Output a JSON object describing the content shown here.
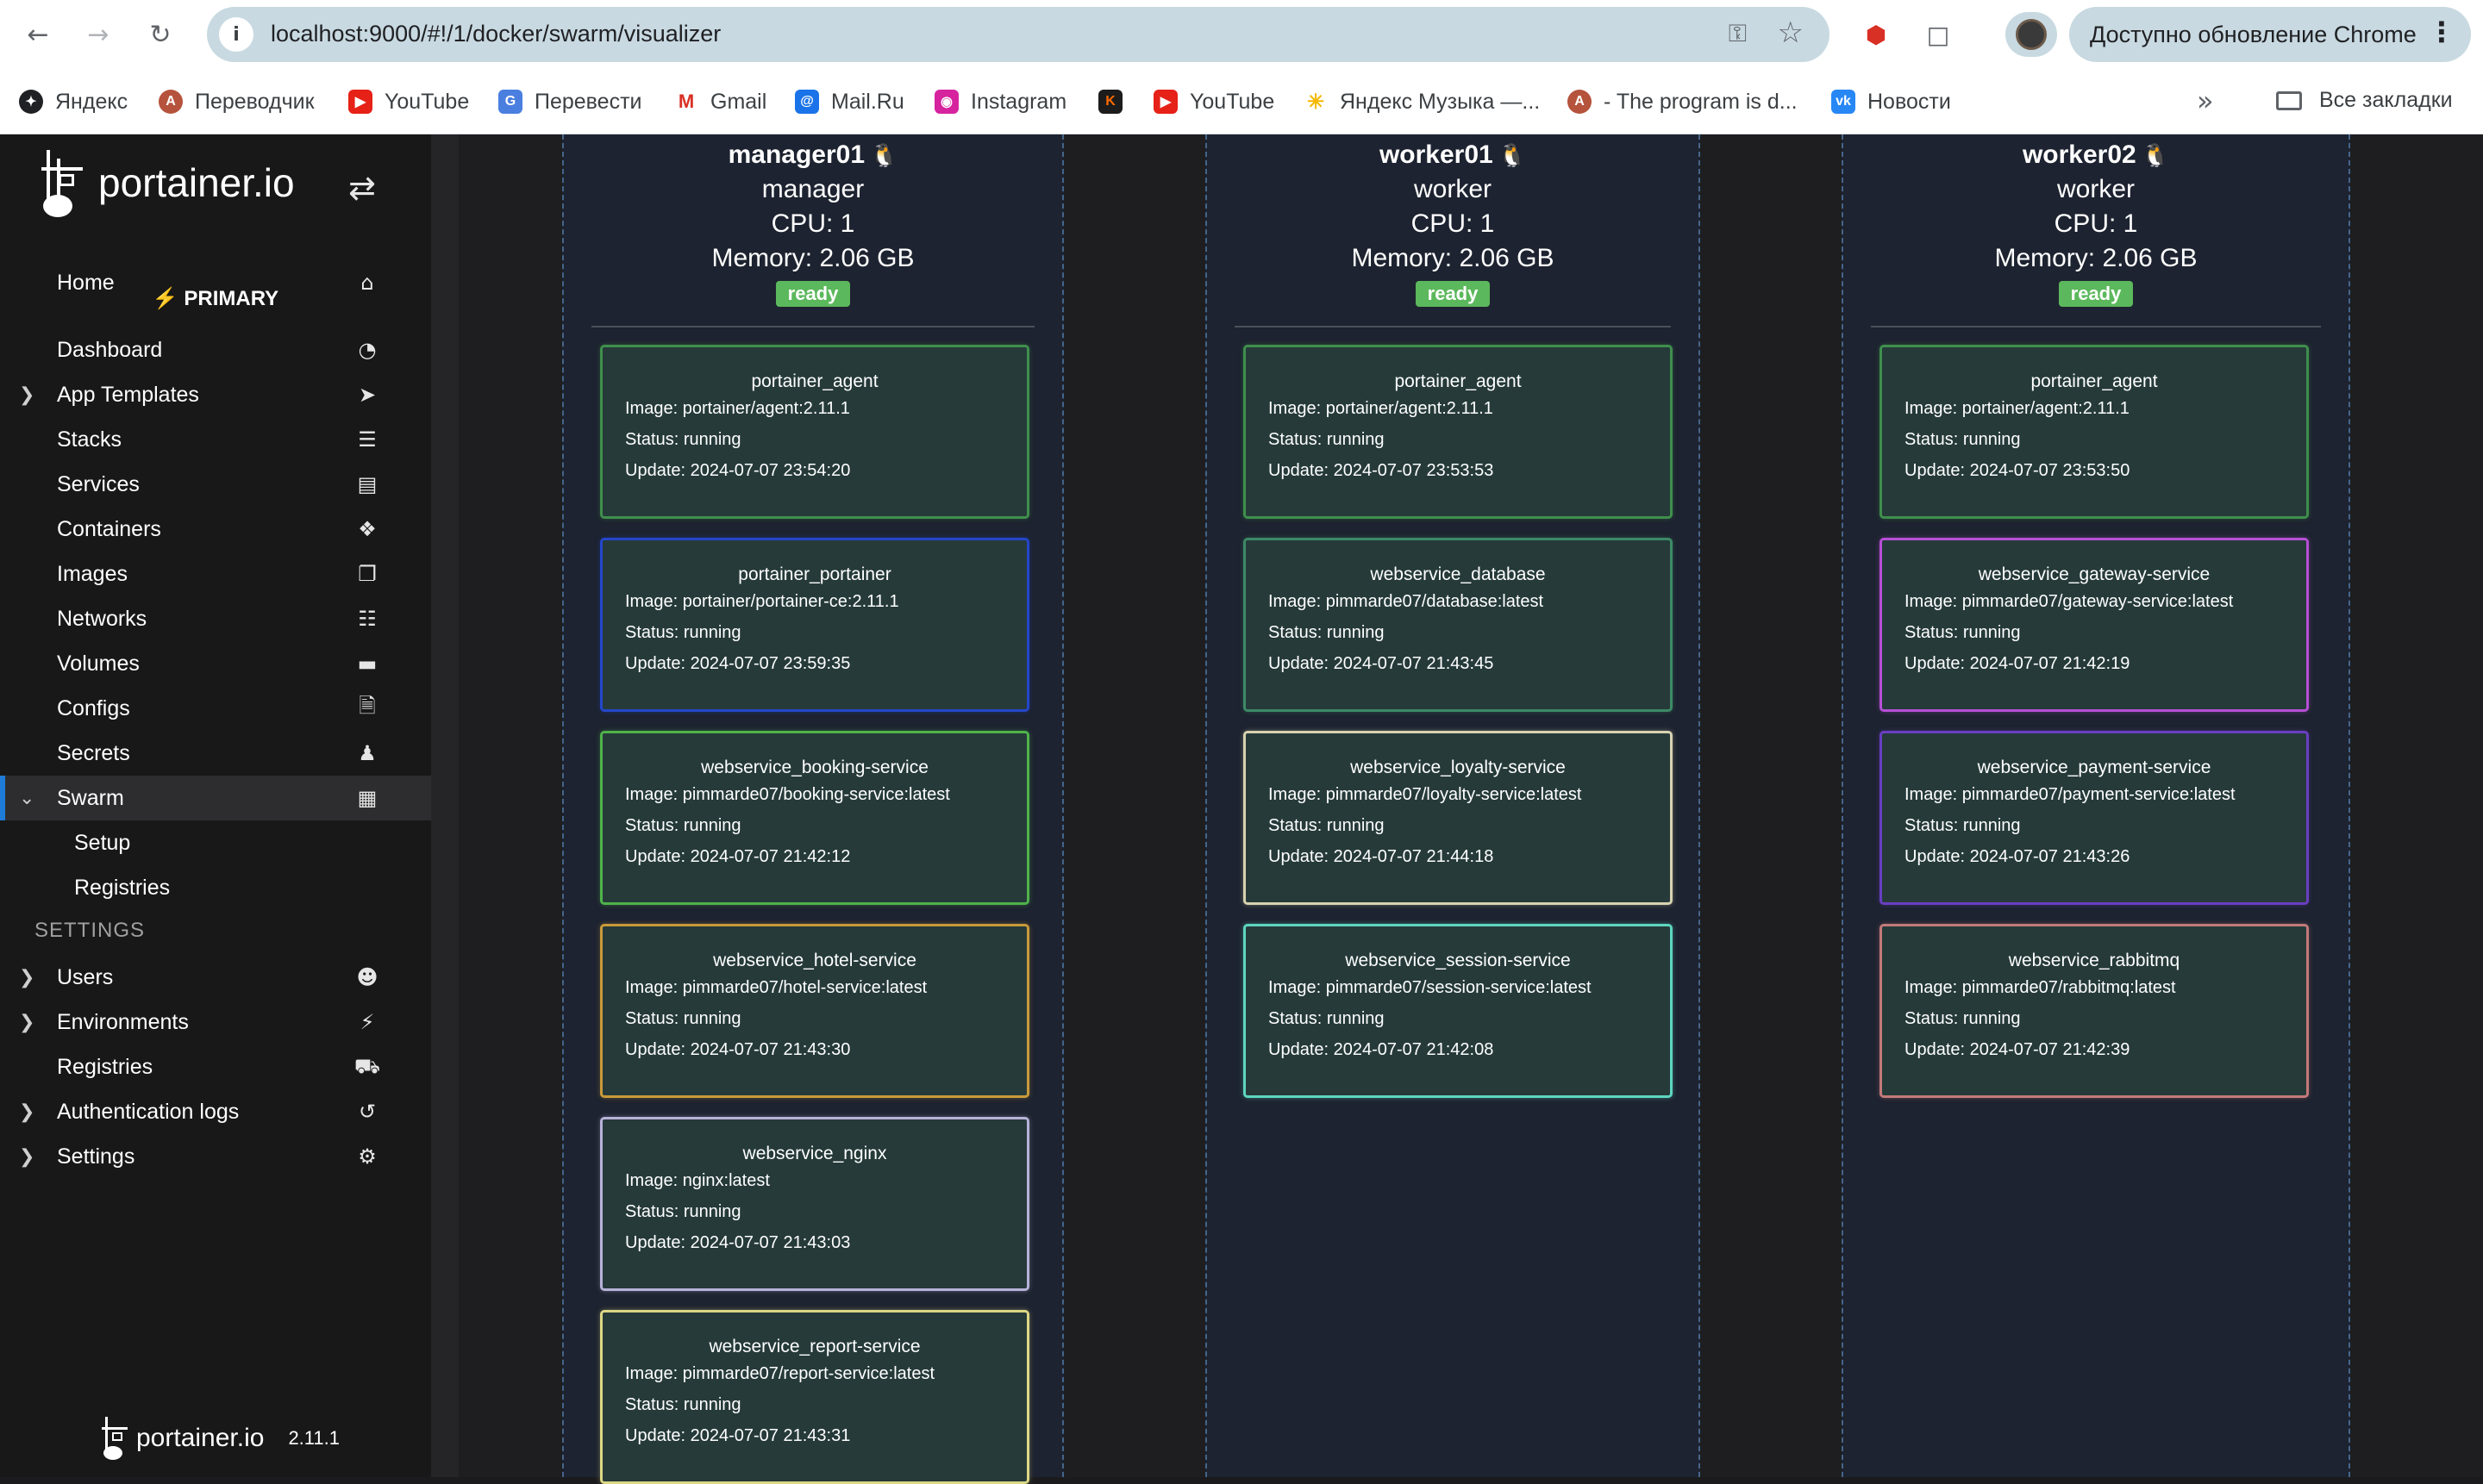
{
  "browser": {
    "url": "localhost:9000/#!/1/docker/swarm/visualizer",
    "update_label": "Доступно обновление Chrome",
    "bookmarks": [
      "Яндекс",
      "Переводчик",
      "YouTube",
      "Перевести",
      "Gmail",
      "Mail.Ru",
      "Instagram",
      "",
      "YouTube",
      "Яндекс Музыка —...",
      "- The program is d...",
      "Новости"
    ],
    "all_bookmarks": "Все закладки"
  },
  "sidebar": {
    "logo_text": "portainer.io",
    "environment": "PRIMARY",
    "items": [
      {
        "label": "Home",
        "icon": "home-icon"
      },
      {
        "label": "Dashboard",
        "icon": "gauge-icon"
      },
      {
        "label": "App Templates",
        "icon": "rocket-icon"
      },
      {
        "label": "Stacks",
        "icon": "list-icon"
      },
      {
        "label": "Services",
        "icon": "services-icon"
      },
      {
        "label": "Containers",
        "icon": "cubes-icon"
      },
      {
        "label": "Images",
        "icon": "clone-icon"
      },
      {
        "label": "Networks",
        "icon": "sitemap-icon"
      },
      {
        "label": "Volumes",
        "icon": "hdd-icon"
      },
      {
        "label": "Configs",
        "icon": "file-code-icon"
      },
      {
        "label": "Secrets",
        "icon": "user-secret-icon"
      },
      {
        "label": "Swarm",
        "icon": "object-group-icon"
      },
      {
        "label": "Setup"
      },
      {
        "label": "Registries"
      }
    ],
    "settings_header": "SETTINGS",
    "settings_items": [
      {
        "label": "Users",
        "icon": "users-icon"
      },
      {
        "label": "Environments",
        "icon": "plug-icon"
      },
      {
        "label": "Registries",
        "icon": "database-icon"
      },
      {
        "label": "Authentication logs",
        "icon": "history-icon"
      },
      {
        "label": "Settings",
        "icon": "cogs-icon"
      }
    ],
    "footer_logo": "portainer.io",
    "version": "2.11.1"
  },
  "nodes": [
    {
      "name": "manager01",
      "role": "manager",
      "cpu": "CPU: 1",
      "memory": "Memory: 2.06 GB",
      "status": "ready",
      "tasks": [
        {
          "name": "portainer_agent",
          "image": "Image: portainer/agent:2.11.1",
          "status": "Status: running",
          "update": "Update: 2024-07-07 23:54:20",
          "color": "#3f8f4c"
        },
        {
          "name": "portainer_portainer",
          "image": "Image: portainer/portainer-ce:2.11.1",
          "status": "Status: running",
          "update": "Update: 2024-07-07 23:59:35",
          "color": "#2447c9"
        },
        {
          "name": "webservice_booking-service",
          "image": "Image: pimmarde07/booking-service:latest",
          "status": "Status: running",
          "update": "Update: 2024-07-07 21:42:12",
          "color": "#4fb34b"
        },
        {
          "name": "webservice_hotel-service",
          "image": "Image: pimmarde07/hotel-service:latest",
          "status": "Status: running",
          "update": "Update: 2024-07-07 21:43:30",
          "color": "#c99a3a"
        },
        {
          "name": "webservice_nginx",
          "image": "Image: nginx:latest",
          "status": "Status: running",
          "update": "Update: 2024-07-07 21:43:03",
          "color": "#b7b2d8"
        },
        {
          "name": "webservice_report-service",
          "image": "Image: pimmarde07/report-service:latest",
          "status": "Status: running",
          "update": "Update: 2024-07-07 21:43:31",
          "color": "#dcd785"
        }
      ]
    },
    {
      "name": "worker01",
      "role": "worker",
      "cpu": "CPU: 1",
      "memory": "Memory: 2.06 GB",
      "status": "ready",
      "tasks": [
        {
          "name": "portainer_agent",
          "image": "Image: portainer/agent:2.11.1",
          "status": "Status: running",
          "update": "Update: 2024-07-07 23:53:53",
          "color": "#3f8f4c"
        },
        {
          "name": "webservice_database",
          "image": "Image: pimmarde07/database:latest",
          "status": "Status: running",
          "update": "Update: 2024-07-07 21:43:45",
          "color": "#3c8a66"
        },
        {
          "name": "webservice_loyalty-service",
          "image": "Image: pimmarde07/loyalty-service:latest",
          "status": "Status: running",
          "update": "Update: 2024-07-07 21:44:18",
          "color": "#d8d2b0"
        },
        {
          "name": "webservice_session-service",
          "image": "Image: pimmarde07/session-service:latest",
          "status": "Status: running",
          "update": "Update: 2024-07-07 21:42:08",
          "color": "#5ed6c0"
        }
      ]
    },
    {
      "name": "worker02",
      "role": "worker",
      "cpu": "CPU: 1",
      "memory": "Memory: 2.06 GB",
      "status": "ready",
      "tasks": [
        {
          "name": "portainer_agent",
          "image": "Image: portainer/agent:2.11.1",
          "status": "Status: running",
          "update": "Update: 2024-07-07 23:53:50",
          "color": "#3f8f4c"
        },
        {
          "name": "webservice_gateway-service",
          "image": "Image: pimmarde07/gateway-service:latest",
          "status": "Status: running",
          "update": "Update: 2024-07-07 21:42:19",
          "color": "#b64fd6"
        },
        {
          "name": "webservice_payment-service",
          "image": "Image: pimmarde07/payment-service:latest",
          "status": "Status: running",
          "update": "Update: 2024-07-07 21:43:26",
          "color": "#6a3fc2"
        },
        {
          "name": "webservice_rabbitmq",
          "image": "Image: pimmarde07/rabbitmq:latest",
          "status": "Status: running",
          "update": "Update: 2024-07-07 21:42:39",
          "color": "#c47a7a"
        }
      ]
    }
  ]
}
